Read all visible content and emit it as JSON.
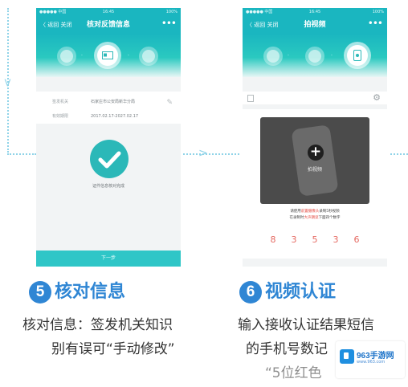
{
  "colors": {
    "accent": "#2f86d4",
    "teal": "#1ab6c0",
    "red": "#e2453c"
  },
  "phone1": {
    "status": {
      "carrier": "●●●●● 中国",
      "time": "16:45",
      "battery": "100%"
    },
    "nav": {
      "back": "〈 返回  关闭",
      "title": "核对反馈信息",
      "more": "•••"
    },
    "fields": [
      {
        "key": "签发机关",
        "value": "石家庄市公安局新华分局"
      },
      {
        "key": "有效期限",
        "value": "2017.02.17-2027.02.17"
      }
    ],
    "status_caption": "证件信息核对完成",
    "button": "下一步"
  },
  "phone2": {
    "status": {
      "carrier": "●●●●● 中国",
      "time": "16:45",
      "battery": "100%"
    },
    "nav": {
      "back": "〈 返回  关闭",
      "title": "拍视频",
      "more": "•••"
    },
    "video": {
      "plus": "+",
      "label": "拍视频"
    },
    "hint": {
      "line1_a": "请使用",
      "line1_b": "前置摄像头",
      "line1_c": "录制5秒视频",
      "line2_a": "在录制时",
      "line2_b": "大声朗读",
      "line2_c": "下面四个数字"
    },
    "digits": [
      "8",
      "3",
      "5",
      "3",
      "6"
    ]
  },
  "step5": {
    "number": "5",
    "title": "核对信息",
    "line1": "核对信息：签发机关知识",
    "line2": "别有误可“手动修改”"
  },
  "step6": {
    "number": "6",
    "title": "视频认证",
    "line1": "输入接收认证结果短信",
    "line2": "的手机号数记",
    "line3": "“5位红色"
  },
  "watermark": {
    "title": "963手游网",
    "url": "www.963.com"
  }
}
